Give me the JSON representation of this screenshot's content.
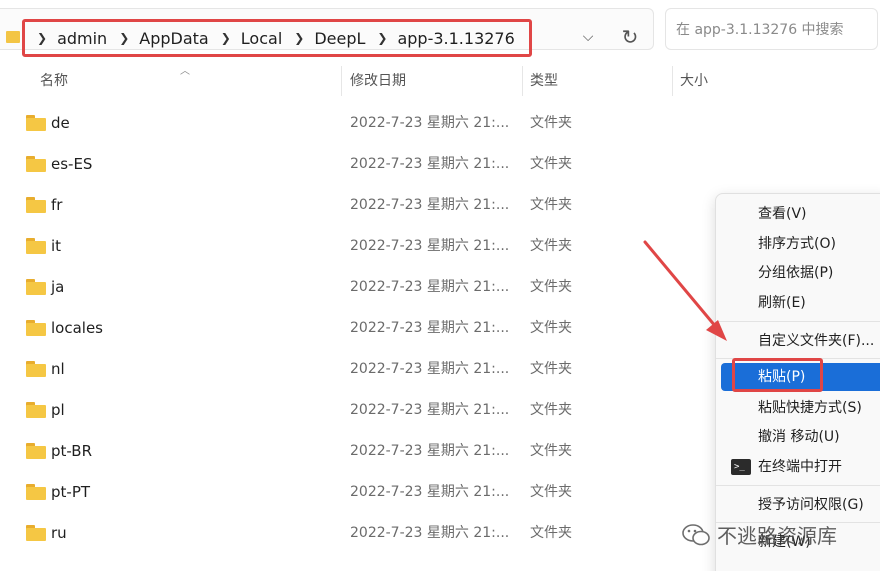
{
  "address_bar": {
    "breadcrumbs": [
      "admin",
      "AppData",
      "Local",
      "DeepL",
      "app-3.1.13276"
    ],
    "search_placeholder": "在 app-3.1.13276 中搜索"
  },
  "columns": {
    "name": "名称",
    "date": "修改日期",
    "type": "类型",
    "size": "大小"
  },
  "files": [
    {
      "name": "de",
      "date": "2022-7-23 星期六 21:...",
      "type": "文件夹"
    },
    {
      "name": "es-ES",
      "date": "2022-7-23 星期六 21:...",
      "type": "文件夹"
    },
    {
      "name": "fr",
      "date": "2022-7-23 星期六 21:...",
      "type": "文件夹"
    },
    {
      "name": "it",
      "date": "2022-7-23 星期六 21:...",
      "type": "文件夹"
    },
    {
      "name": "ja",
      "date": "2022-7-23 星期六 21:...",
      "type": "文件夹"
    },
    {
      "name": "locales",
      "date": "2022-7-23 星期六 21:...",
      "type": "文件夹"
    },
    {
      "name": "nl",
      "date": "2022-7-23 星期六 21:...",
      "type": "文件夹"
    },
    {
      "name": "pl",
      "date": "2022-7-23 星期六 21:...",
      "type": "文件夹"
    },
    {
      "name": "pt-BR",
      "date": "2022-7-23 星期六 21:...",
      "type": "文件夹"
    },
    {
      "name": "pt-PT",
      "date": "2022-7-23 星期六 21:...",
      "type": "文件夹"
    },
    {
      "name": "ru",
      "date": "2022-7-23 星期六 21:...",
      "type": "文件夹"
    }
  ],
  "context_menu": {
    "view": "查看(V)",
    "sort": "排序方式(O)",
    "group": "分组依据(P)",
    "refresh": "刷新(E)",
    "customize": "自定义文件夹(F)...",
    "paste": "粘贴(P)",
    "paste_shortcut": "粘贴快捷方式(S)",
    "undo": "撤消 移动(U)",
    "open_terminal": "在终端中打开",
    "give_access": "授予访问权限(G)",
    "new": "新建(W)"
  },
  "watermark": "不逃路资源库",
  "colors": {
    "highlight_box": "#e04646",
    "selection": "#1a6ed8",
    "folder": "#f5c744"
  }
}
